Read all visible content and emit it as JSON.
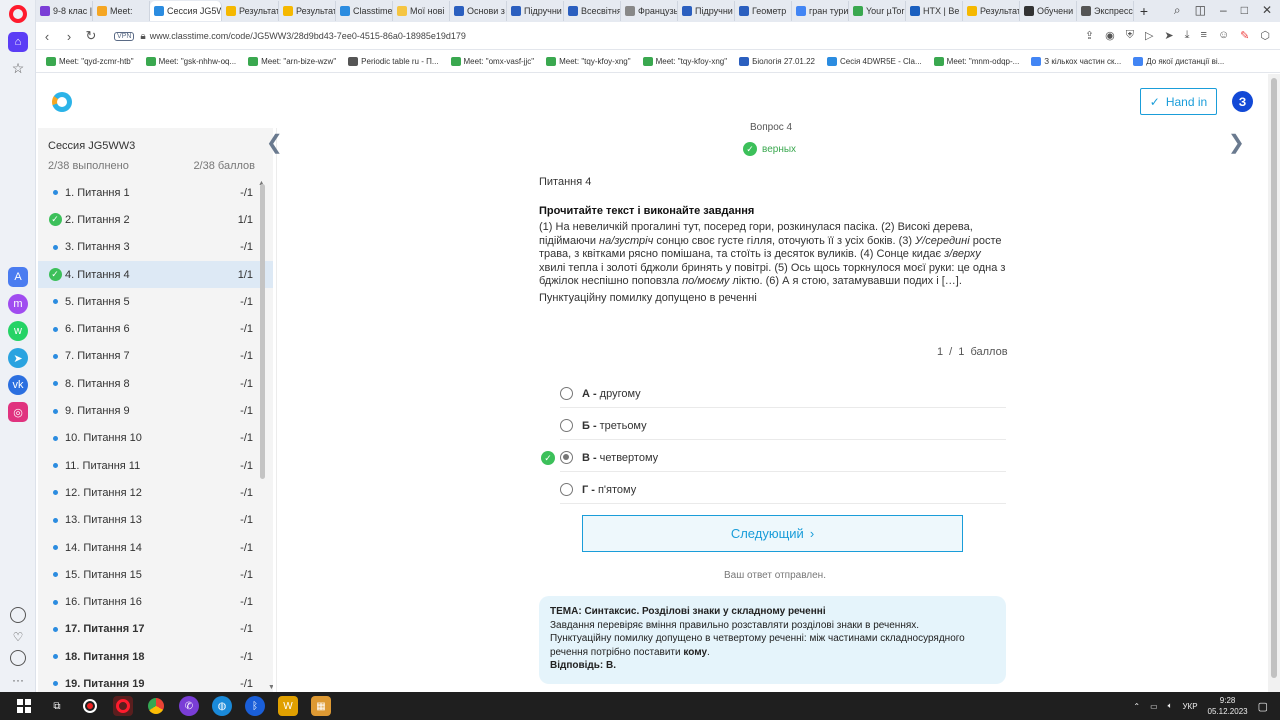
{
  "browser": {
    "tabs": [
      {
        "label": "9-8 клас |",
        "color": "#7a3dd6"
      },
      {
        "label": "Meet:",
        "color": "#f5a623"
      },
      {
        "label": "Сессия JG5WW3",
        "color": "#2b8ce0",
        "active": true
      },
      {
        "label": "Результат",
        "color": "#f5b800"
      },
      {
        "label": "Результат",
        "color": "#f5b800"
      },
      {
        "label": "Classtime",
        "color": "#2b8ce0"
      },
      {
        "label": "Мої нові",
        "color": "#f5c542"
      },
      {
        "label": "Основи з",
        "color": "#2b5fbf"
      },
      {
        "label": "Підручни",
        "color": "#2b5fbf"
      },
      {
        "label": "Всесвітня",
        "color": "#2b5fbf"
      },
      {
        "label": "Французь",
        "color": "#888888"
      },
      {
        "label": "Підручни",
        "color": "#2b5fbf"
      },
      {
        "label": "Геометр",
        "color": "#2b5fbf"
      },
      {
        "label": "гран тури",
        "color": "#4285f4"
      },
      {
        "label": "Your µTor",
        "color": "#3aa84f"
      },
      {
        "label": "НТХ | Ве",
        "color": "#1a5fbf"
      },
      {
        "label": "Результат",
        "color": "#f5b800"
      },
      {
        "label": "Обучени",
        "color": "#333333"
      },
      {
        "label": "Экспресс",
        "color": "#555555"
      }
    ],
    "url": "www.classtime.com/code/JG5WW3/28d9bd43-7ee0-4515-86a0-18985e19d179",
    "vpn": "VPN",
    "bookmarks": [
      {
        "label": "Meet: \"qyd-zcmr-htb\"",
        "color": "#3aa84f"
      },
      {
        "label": "Meet: \"gsk-nhhw-oq...",
        "color": "#3aa84f"
      },
      {
        "label": "Meet: \"arn-bize-wzw\"",
        "color": "#3aa84f"
      },
      {
        "label": "Periodic table ru - П...",
        "color": "#555555"
      },
      {
        "label": "Meet: \"omx-vasf-jjc\"",
        "color": "#3aa84f"
      },
      {
        "label": "Meet: \"tqy-kfoy-xng\"",
        "color": "#3aa84f"
      },
      {
        "label": "Meet: \"tqy-kfoy-xng\"",
        "color": "#3aa84f"
      },
      {
        "label": "Біологія 27.01.22",
        "color": "#2b5fbf"
      },
      {
        "label": "Сесія 4DWR5E - Cla...",
        "color": "#2b8ce0"
      },
      {
        "label": "Meet: \"mnm-odqp-...",
        "color": "#3aa84f"
      },
      {
        "label": "З кількох частин ск...",
        "color": "#4285f4"
      },
      {
        "label": "До якої дистанції ві...",
        "color": "#4285f4"
      }
    ]
  },
  "header": {
    "hand_in": "Hand in",
    "avatar_letter": "З"
  },
  "sidebar": {
    "session_title": "Сессия JG5WW3",
    "progress": "2/38 выполнено",
    "score": "2/38 баллов",
    "items": [
      {
        "label": "1. Питання 1",
        "score": "-/1",
        "status": "pending"
      },
      {
        "label": "2. Питання 2",
        "score": "1/1",
        "status": "correct"
      },
      {
        "label": "3. Питання 3",
        "score": "-/1",
        "status": "pending"
      },
      {
        "label": "4. Питання 4",
        "score": "1/1",
        "status": "correct",
        "active": true
      },
      {
        "label": "5. Питання 5",
        "score": "-/1",
        "status": "pending"
      },
      {
        "label": "6. Питання 6",
        "score": "-/1",
        "status": "pending"
      },
      {
        "label": "7. Питання 7",
        "score": "-/1",
        "status": "pending"
      },
      {
        "label": "8. Питання 8",
        "score": "-/1",
        "status": "pending"
      },
      {
        "label": "9. Питання 9",
        "score": "-/1",
        "status": "pending"
      },
      {
        "label": "10. Питання 10",
        "score": "-/1",
        "status": "pending"
      },
      {
        "label": "11. Питання 11",
        "score": "-/1",
        "status": "pending"
      },
      {
        "label": "12. Питання 12",
        "score": "-/1",
        "status": "pending"
      },
      {
        "label": "13. Питання 13",
        "score": "-/1",
        "status": "pending"
      },
      {
        "label": "14. Питання 14",
        "score": "-/1",
        "status": "pending"
      },
      {
        "label": "15. Питання 15",
        "score": "-/1",
        "status": "pending"
      },
      {
        "label": "16. Питання 16",
        "score": "-/1",
        "status": "pending"
      },
      {
        "label": "17. Питання 17",
        "score": "-/1",
        "status": "pending",
        "bold": true
      },
      {
        "label": "18. Питання 18",
        "score": "-/1",
        "status": "pending",
        "bold": true
      },
      {
        "label": "19. Питання 19",
        "score": "-/1",
        "status": "pending",
        "bold": true
      }
    ]
  },
  "question": {
    "number_label": "Вопрос 4",
    "status": "верных",
    "title": "Питання 4",
    "instruction": "Прочитайте текст і виконайте завдання",
    "text_parts": [
      {
        "t": "(1) На невеличкій прогалині тут, посеред гори, розкинулася пасіка. (2) Високі дерева, підіймаючи "
      },
      {
        "t": "на/зустріч",
        "i": true
      },
      {
        "t": " сонцю своє густе гілля, оточують її з усіх боків. (3) "
      },
      {
        "t": "У/середині",
        "i": true
      },
      {
        "t": " росте трава, з квітками рясно помішана, та стоїть із десяток вуликів. (4) Сонце кидає "
      },
      {
        "t": "з/верху",
        "i": true
      },
      {
        "t": " хвилі тепла і золоті бджоли бринять у повітрі. (5) Ось щось торкнулося моєї руки: це одна з бджілок неспішно поповзла "
      },
      {
        "t": "по/моєму",
        "i": true
      },
      {
        "t": " ліктю. (6) А я стою, затамувавши подих і […]."
      }
    ],
    "prompt": "Пунктуаційну помилку допущено в реченні",
    "points": "1 / 1 баллов",
    "options": [
      {
        "letter": "А -",
        "text": "другому",
        "selected": false,
        "correct": false
      },
      {
        "letter": "Б -",
        "text": "третьому",
        "selected": false,
        "correct": false
      },
      {
        "letter": "В -",
        "text": "четвертому",
        "selected": true,
        "correct": true
      },
      {
        "letter": "Г -",
        "text": "п'ятому",
        "selected": false,
        "correct": false
      }
    ],
    "next_button": "Следующий",
    "sent_message": "Ваш ответ отправлен.",
    "explanation": {
      "topic": "ТЕМА: Синтаксис. Розділові знаки у складному реченні",
      "line1": "Завдання перевіряє вміння правильно розставляти розділові знаки в реченнях.",
      "line2_pre": "Пунктуаційну помилку допущено в четвертому реченні: між частинами складносурядного речення потрібно поставити ",
      "line2_bold": "кому",
      "line2_post": ".",
      "answer": "Відповідь: В."
    }
  },
  "taskbar": {
    "lang": "УКР",
    "time": "9:28",
    "date": "05.12.2023"
  }
}
